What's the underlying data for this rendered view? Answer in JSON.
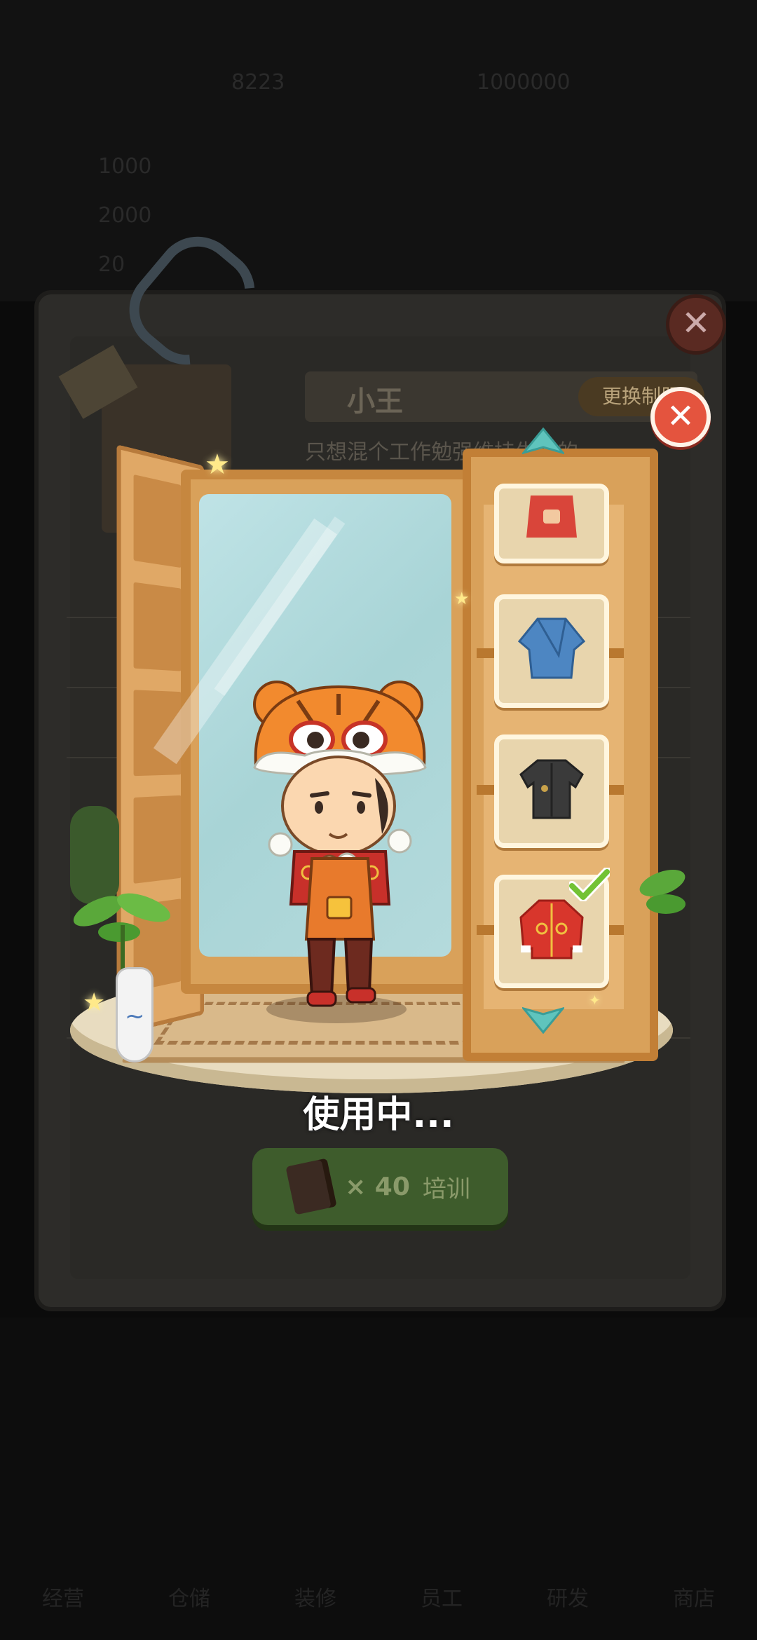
{
  "background": {
    "faint_values": [
      "8223",
      "1000000",
      "1000",
      "2000",
      "20"
    ],
    "nav_labels": [
      "经营",
      "仓储",
      "装修",
      "员工",
      "研发",
      "商店"
    ]
  },
  "card": {
    "employee_name": "小王",
    "uniform_button": "更换制服",
    "description": "只想混个工作勉强维持生计的",
    "close_label": "✕"
  },
  "wardrobe": {
    "items": [
      {
        "name": "red-apron-outfit",
        "color": "#d9453a"
      },
      {
        "name": "blue-robe",
        "color": "#4d86c2"
      },
      {
        "name": "black-shirt",
        "color": "#3a3a3a"
      },
      {
        "name": "red-tang-jacket",
        "color": "#d8362c",
        "selected": true
      }
    ],
    "close_label": "✕"
  },
  "status_text": "使用中...",
  "train_button": {
    "count": "× 40",
    "label": "培训"
  },
  "colors": {
    "accent_green": "#73c234",
    "close_red": "#e4543e",
    "wood": "#d9a15a"
  }
}
